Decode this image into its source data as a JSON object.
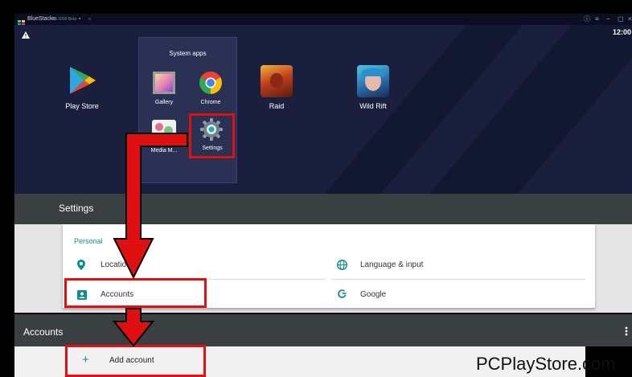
{
  "window": {
    "app_name": "BlueStacks",
    "version": "4.8.1000 Beta",
    "clock": "12:00"
  },
  "home": {
    "apps": [
      {
        "label": "Play Store"
      },
      {
        "label": "Raid"
      },
      {
        "label": "Wild Rift"
      }
    ],
    "system_apps": {
      "title": "System apps",
      "items": [
        {
          "label": "Gallery"
        },
        {
          "label": "Chrome"
        },
        {
          "label": "Media M..."
        },
        {
          "label": "Settings"
        }
      ]
    }
  },
  "settings": {
    "title": "Settings",
    "section": "Personal",
    "rows": [
      {
        "label": "Location",
        "icon": "location-pin-icon"
      },
      {
        "label": "Language & input",
        "icon": "globe-icon"
      },
      {
        "label": "Accounts",
        "icon": "contact-card-icon"
      },
      {
        "label": "Google",
        "icon": "google-g-icon"
      }
    ]
  },
  "accounts": {
    "title": "Accounts",
    "add_label": "Add account",
    "add_icon": "+"
  },
  "watermark": "PCPlayStore.com",
  "colors": {
    "accent_teal": "#16908b",
    "highlight_red": "#e01010",
    "home_bg": "#1a1f3d",
    "header_bg": "#3a3f41"
  }
}
